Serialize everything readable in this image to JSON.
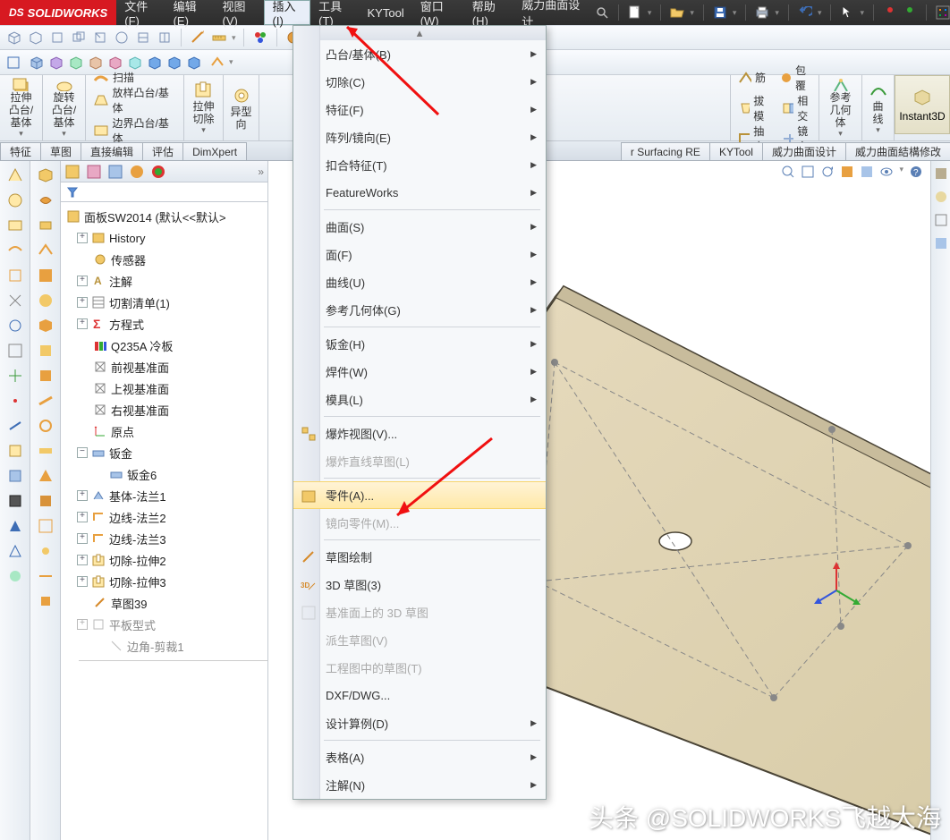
{
  "app": {
    "brand": "SOLIDWORKS"
  },
  "menu": {
    "file": "文件(F)",
    "edit": "编辑(E)",
    "view": "视图(V)",
    "insert": "插入(I)",
    "tools": "工具(T)",
    "kytool": "KYTool",
    "window": "窗口(W)",
    "help": "帮助(H)",
    "weili": "威力曲面设计"
  },
  "ribbon": {
    "extrude": "拉伸凸台/基体",
    "revolve": "旋转凸台/基体",
    "sweep": "扫描",
    "loft": "放样凸台/基体",
    "boundary": "边界凸台/基体",
    "cut_extrude": "拉伸切除",
    "cut_wizard": "异型孔向导",
    "rib": "筋",
    "wrap": "包覆",
    "draft": "拔模",
    "intersect": "相交",
    "shell": "抽壳",
    "mirror": "镜向",
    "refgeom": "参考几何体",
    "curves": "曲线",
    "instant3d": "Instant3D"
  },
  "tabs": {
    "features": "特征",
    "sketch": "草图",
    "directedit": "直接编辑",
    "evaluate": "评估",
    "dimxpert": "DimXpert",
    "surfacing": "r Surfacing RE",
    "kytool": "KYTool",
    "weili1": "威力曲面设计",
    "weili2": "威力曲面結構修改"
  },
  "tree": {
    "root": "面板SW2014  (默认<<默认>",
    "history": "History",
    "sensors": "传感器",
    "anno": "注解",
    "cutlist": "切割清单(1)",
    "equations": "方程式",
    "material": "Q235A 冷板",
    "front": "前视基准面",
    "top": "上视基准面",
    "right": "右视基准面",
    "origin": "原点",
    "sheetmetal": "钣金",
    "sheetmetal6": "钣金6",
    "baseflange": "基体-法兰1",
    "edgeflange2": "边线-法兰2",
    "edgeflange3": "边线-法兰3",
    "cutextrude2": "切除-拉伸2",
    "cutextrude3": "切除-拉伸3",
    "sketch39": "草图39",
    "flatpattern": "平板型式",
    "cornertrim": "边角-剪裁1"
  },
  "insert_menu": {
    "boss": "凸台/基体(B)",
    "cut": "切除(C)",
    "features": "特征(F)",
    "pattern": "阵列/镜向(E)",
    "fasten": "扣合特征(T)",
    "featureworks": "FeatureWorks",
    "surface": "曲面(S)",
    "face": "面(F)",
    "curve": "曲线(U)",
    "refgeom": "参考几何体(G)",
    "sheetmetal": "钣金(H)",
    "weldments": "焊件(W)",
    "molds": "模具(L)",
    "exploded": "爆炸视图(V)...",
    "exploded_line": "爆炸直线草图(L)",
    "part": "零件(A)...",
    "mirror_part": "镜向零件(M)...",
    "sketch_draw": "草图绘制",
    "sketch3d": "3D 草图(3)",
    "sketch3d_plane": "基准面上的 3D 草图",
    "derived": "派生草图(V)",
    "drawing_sketch": "工程图中的草图(T)",
    "dxf": "DXF/DWG...",
    "design_study": "设计算例(D)",
    "tables": "表格(A)",
    "annotations": "注解(N)"
  },
  "watermark": "头条 @SOLIDWORKS飞越大海"
}
